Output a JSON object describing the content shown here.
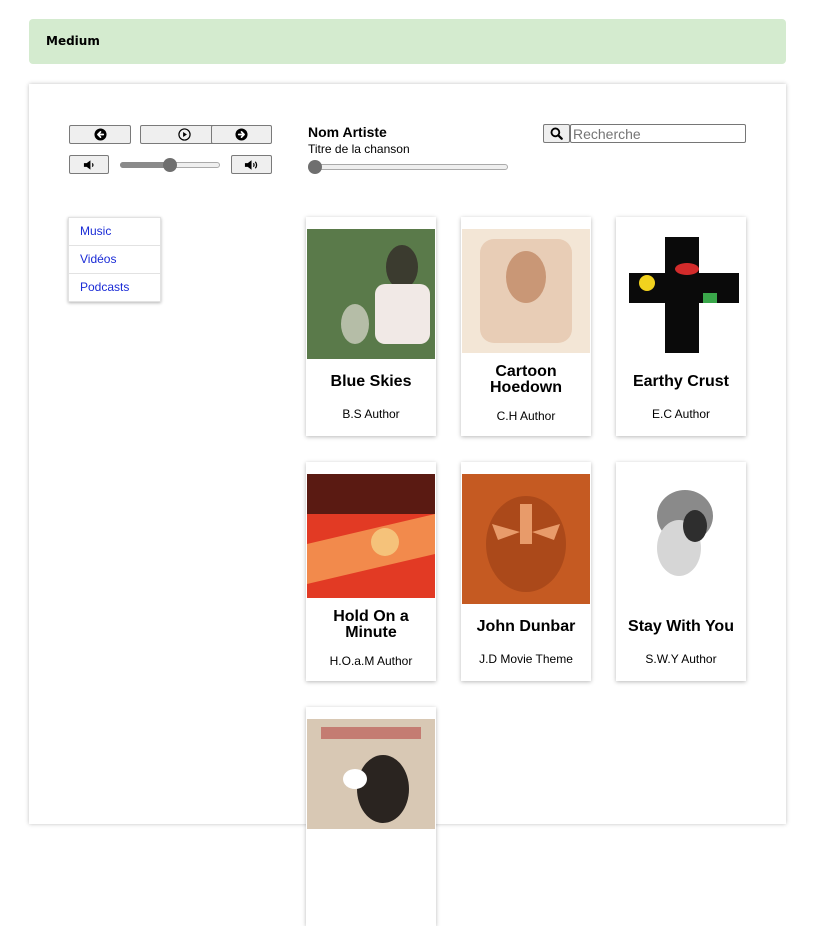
{
  "banner": {
    "label": "Medium"
  },
  "player": {
    "artist": "Nom Artiste",
    "song": "Titre de la chanson",
    "volume_fraction": 0.5,
    "progress_fraction": 0.0,
    "icons": {
      "prev": "arrow-left-circle-icon",
      "play": "play-circle-icon",
      "next": "arrow-right-circle-icon",
      "volume_down": "volume-down-icon",
      "volume_up": "volume-up-icon",
      "search": "search-icon"
    }
  },
  "search": {
    "placeholder": "Recherche",
    "value": ""
  },
  "nav": {
    "items": [
      {
        "label": "Music"
      },
      {
        "label": "Vidéos"
      },
      {
        "label": "Podcasts"
      }
    ]
  },
  "albums": [
    {
      "title": "Blue Skies",
      "author": "B.S Author",
      "colors": [
        "#5a7a4a",
        "#f1e9e6",
        "#3b3b2f"
      ]
    },
    {
      "title": "Cartoon Hoedown",
      "author": "C.H Author",
      "colors": [
        "#e8cdb6",
        "#c99776",
        "#f3e6d6"
      ]
    },
    {
      "title": "Earthy Crust",
      "author": "E.C Author",
      "colors": [
        "#0a0a0a",
        "#d22b2b",
        "#3aa74a"
      ]
    },
    {
      "title": "Hold On a Minute",
      "author": "H.O.a.M Author",
      "colors": [
        "#e23a24",
        "#f28a4c",
        "#5a1a12"
      ]
    },
    {
      "title": "John Dunbar",
      "author": "J.D Movie Theme",
      "colors": [
        "#c55a22",
        "#e89b6a",
        "#7a2a0c"
      ]
    },
    {
      "title": "Stay With You",
      "author": "S.W.Y Author",
      "colors": [
        "#8a8a8a",
        "#d6d6d6",
        "#2e2e2e"
      ]
    },
    {
      "title": "",
      "author": "",
      "colors": [
        "#d8c8b4",
        "#2a2420",
        "#b03030"
      ]
    }
  ]
}
